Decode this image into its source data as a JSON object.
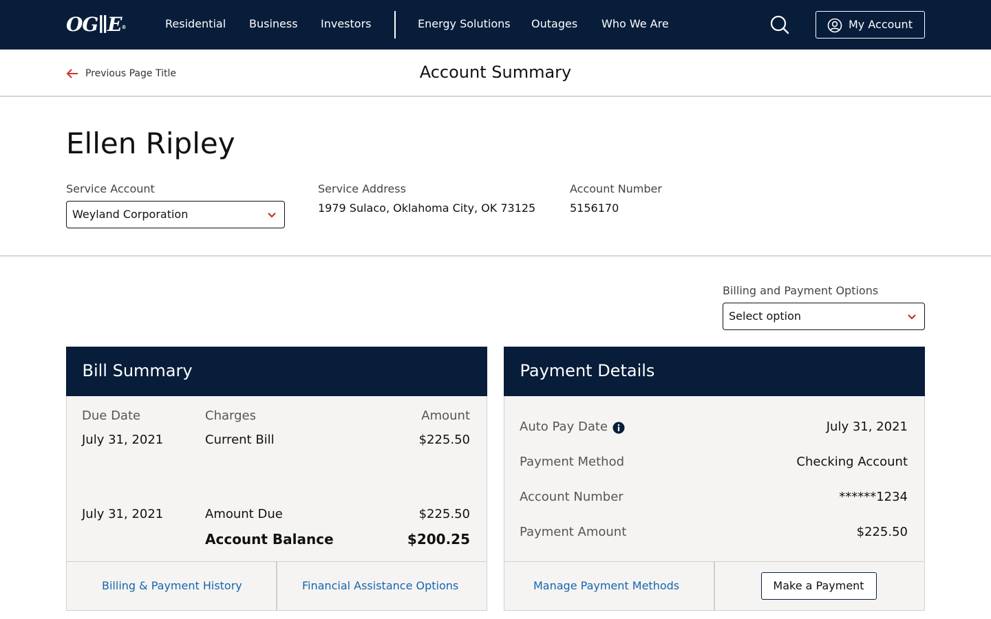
{
  "colors": {
    "nav_bg": "#071d3a",
    "link": "#1565b0",
    "accent_chevron": "#c0241c",
    "card_bg": "#f5f4f2"
  },
  "nav": {
    "logo": "OG∥E",
    "logo_mark": "®",
    "links": [
      "Residential",
      "Business",
      "Investors",
      "Energy Solutions",
      "Outages",
      "Who We Are"
    ],
    "search_icon": "search-icon",
    "account_label": "My Account",
    "account_icon": "user-circle-icon"
  },
  "pagebar": {
    "back_label": "Previous Page Title",
    "back_icon": "arrow-left-icon",
    "title": "Account Summary"
  },
  "customer": {
    "name": "Ellen Ripley",
    "service_account_label": "Service Account",
    "service_account_value": "Weyland Corporation",
    "service_address_label": "Service Address",
    "service_address_value": "1979 Sulaco, Oklahoma City, OK 73125",
    "account_number_label": "Account Number",
    "account_number_value": "5156170"
  },
  "billing_options": {
    "label": "Billing and Payment Options",
    "selected": "Select option"
  },
  "bill_summary": {
    "title": "Bill Summary",
    "headers": {
      "due_date": "Due Date",
      "charges": "Charges",
      "amount": "Amount"
    },
    "rows": [
      {
        "due_date": "July 31, 2021",
        "charge": "Current Bill",
        "amount": "$225.50"
      },
      {
        "due_date": "July 31, 2021",
        "charge": "Amount Due",
        "amount": "$225.50"
      }
    ],
    "balance_label": "Account Balance",
    "balance_value": "$200.25",
    "footer": {
      "history_link": "Billing & Payment History",
      "assistance_link": "Financial Assistance Options"
    }
  },
  "payment_details": {
    "title": "Payment Details",
    "rows": [
      {
        "label": "Auto Pay Date",
        "value": "July 31, 2021"
      },
      {
        "label": "Payment Method",
        "value": "Checking Account"
      },
      {
        "label": "Account Number",
        "value": "******1234"
      },
      {
        "label": "Payment Amount",
        "value": "$225.50"
      }
    ],
    "info_icon": "info-icon",
    "footer": {
      "manage_link": "Manage Payment Methods",
      "pay_button": "Make a Payment"
    }
  }
}
